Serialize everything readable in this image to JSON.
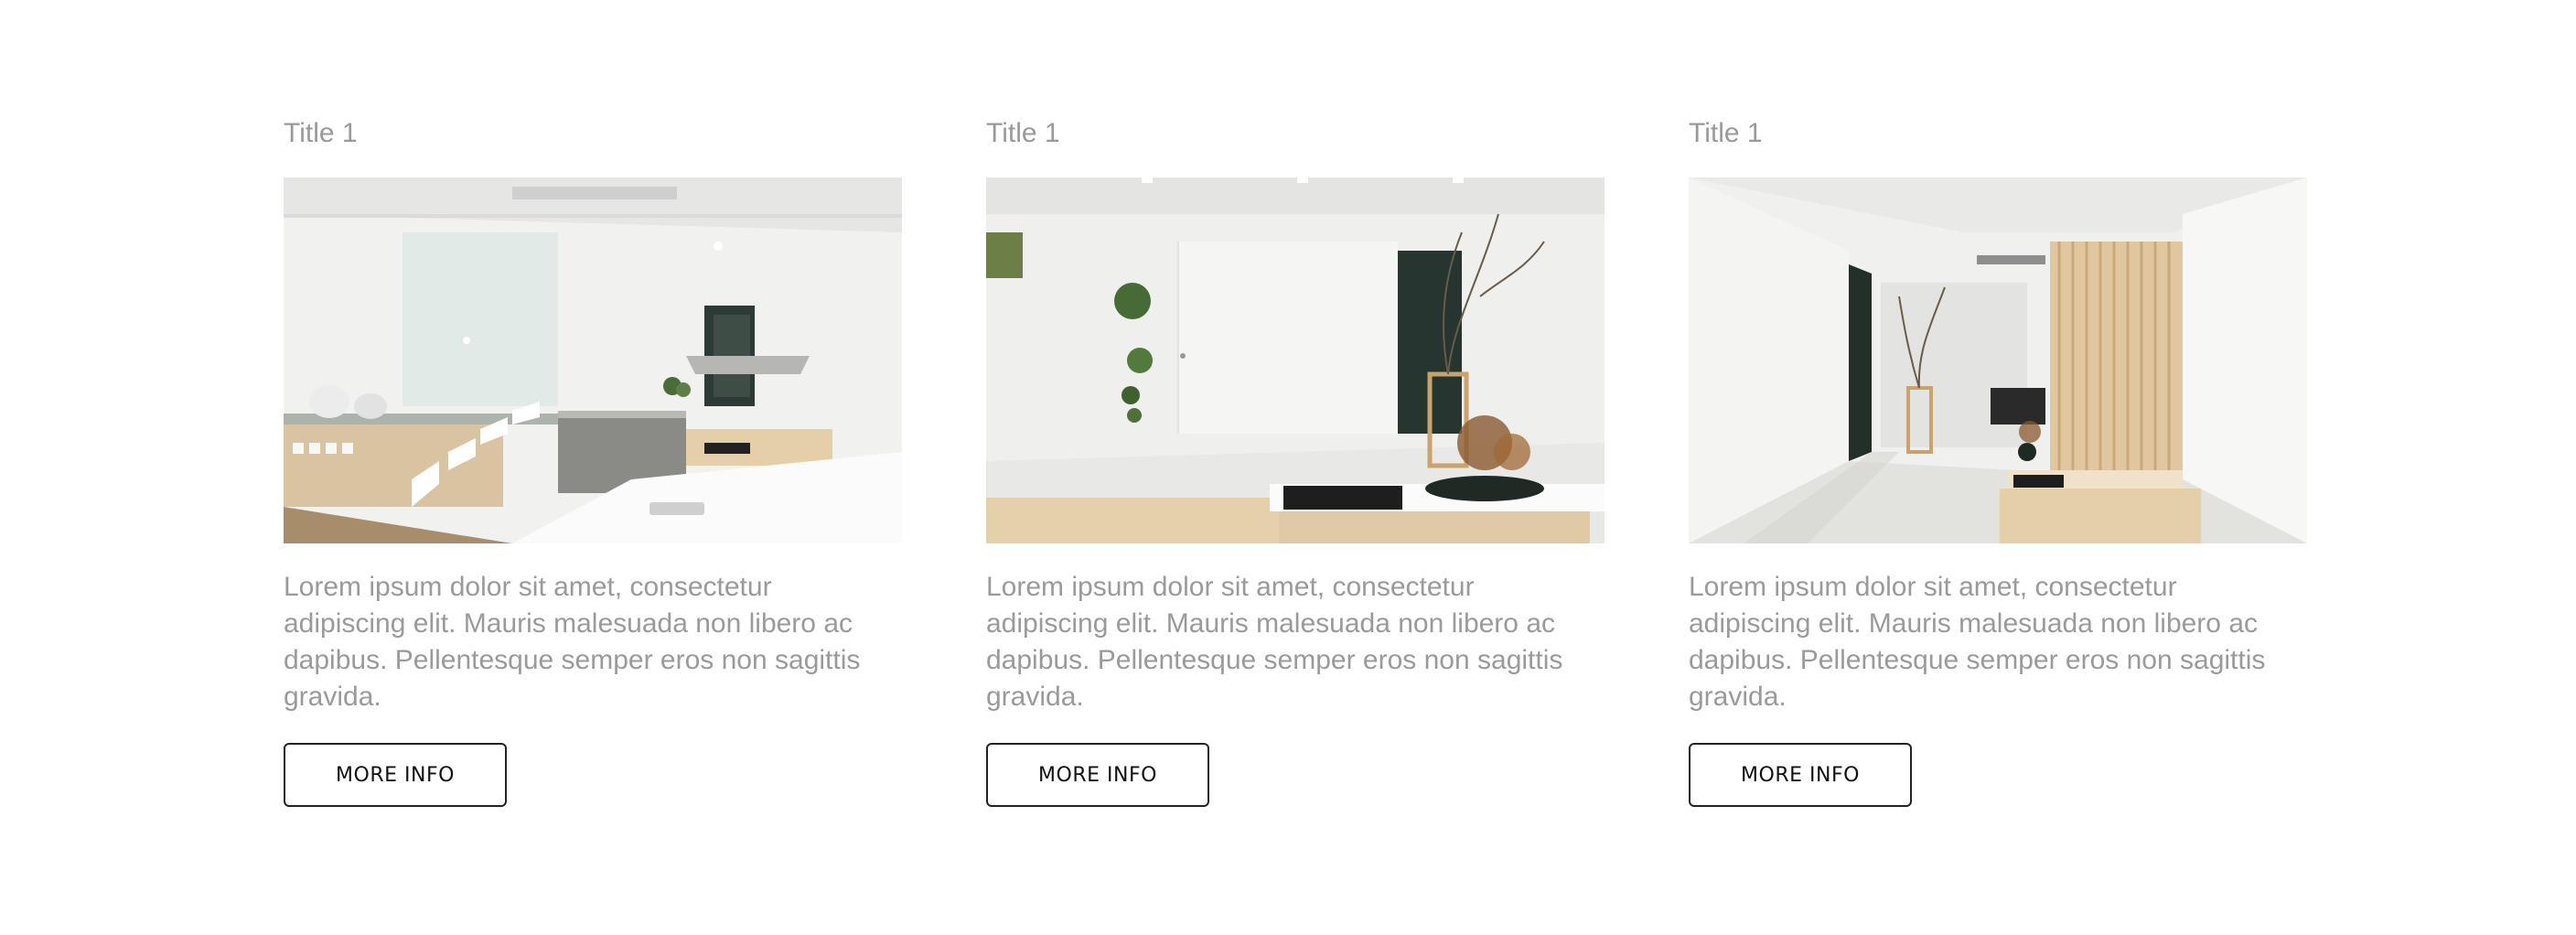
{
  "cards": [
    {
      "title": "Title 1",
      "image_alt": "Modern white kitchen interior with floating staircase",
      "text": "Lorem ipsum dolor sit amet, consectetur adipiscing elit. Mauris malesuada non libero ac dapibus. Pellentesque semper eros non sagittis gravida.",
      "button_label": "MORE INFO"
    },
    {
      "title": "Title 1",
      "image_alt": "Minimalist white room with plant arrangement",
      "text": "Lorem ipsum dolor sit amet, consectetur adipiscing elit. Mauris malesuada non libero ac dapibus. Pellentesque semper eros non sagittis gravida.",
      "button_label": "MORE INFO"
    },
    {
      "title": "Title 1",
      "image_alt": "White hallway with wooden slat screen",
      "text": "Lorem ipsum dolor sit amet, consectetur adipiscing elit. Mauris malesuada non libero ac dapibus. Pellentesque semper eros non sagittis gravida.",
      "button_label": "MORE INFO"
    }
  ]
}
